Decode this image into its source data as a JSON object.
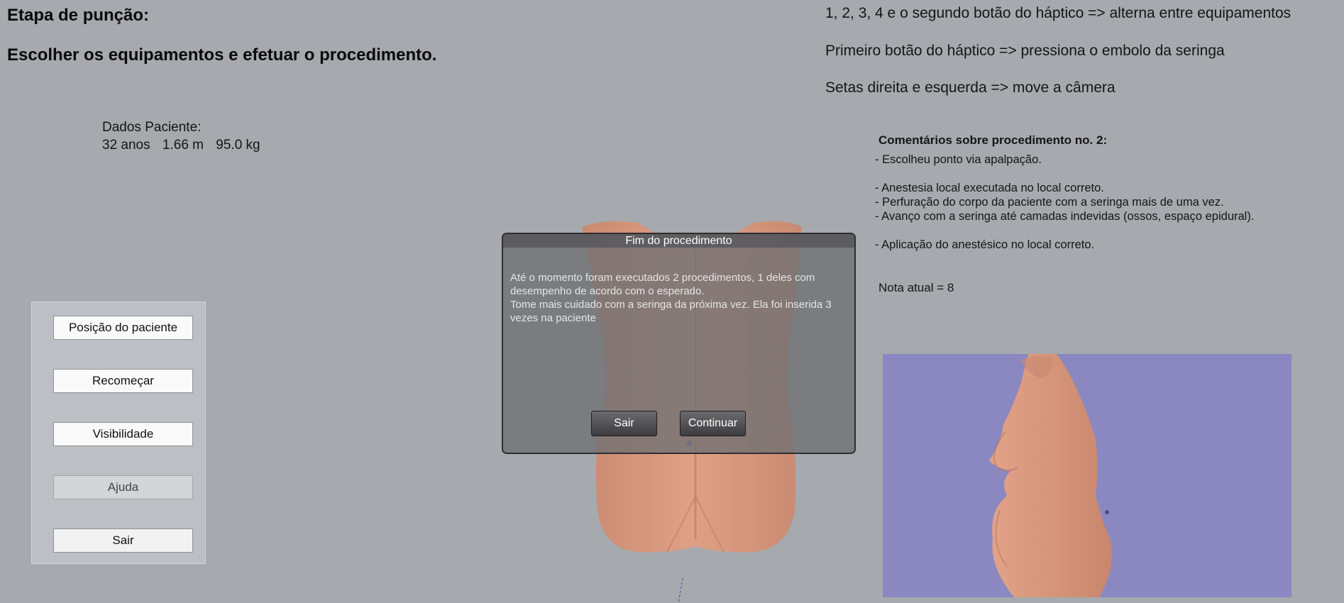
{
  "header": {
    "title": "Etapa de punção:",
    "subtitle": "Escolher os equipamentos e efetuar o procedimento."
  },
  "instructions": [
    "1, 2, 3, 4 e o segundo botão do háptico => alterna entre equipamentos",
    "Primeiro botão do háptico => pressiona o embolo da seringa",
    "Setas direita e esquerda => move a câmera"
  ],
  "patient": {
    "label": "Dados Paciente:",
    "age": "32 anos",
    "height": "1.66 m",
    "weight": "95.0 kg"
  },
  "comments": {
    "title": "Comentários sobre procedimento no. 2:",
    "lines": [
      "- Escolheu ponto via apalpação.",
      "",
      "- Anestesia local executada no local correto.",
      "- Perfuração do corpo da paciente com a seringa mais de uma vez.",
      "- Avanço com a seringa até camadas indevidas (ossos, espaço epidural).",
      "",
      "- Aplicação do anestésico no local correto."
    ],
    "grade": "Nota atual = 8"
  },
  "side_panel": {
    "buttons": [
      {
        "label": "Posição do paciente",
        "enabled": true
      },
      {
        "label": "Recomeçar",
        "enabled": true
      },
      {
        "label": "Visibilidade",
        "enabled": true
      },
      {
        "label": "Ajuda",
        "enabled": false
      },
      {
        "label": "Sair",
        "enabled": true
      }
    ]
  },
  "dialog": {
    "title": "Fim do procedimento",
    "message_line1": "Até o momento foram executados 2 procedimentos, 1 deles com desempenho de acordo com o esperado.",
    "message_line2": "Tome mais cuidado com a seringa da próxima vez. Ela foi inserida 3 vezes na paciente",
    "exit_label": "Sair",
    "continue_label": "Continuar"
  },
  "colors": {
    "background": "#a6a9ad",
    "viewport_background": "#8b88c1",
    "skin": "#d99a80"
  }
}
